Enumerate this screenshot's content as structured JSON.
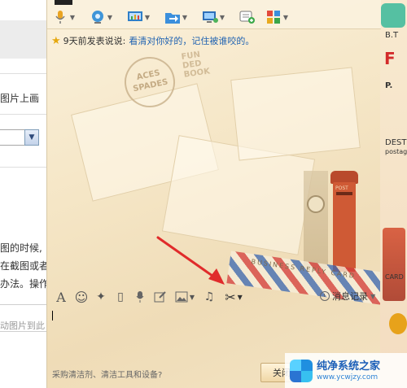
{
  "background_page": {
    "text_line_1": "图片上画",
    "text_line_2": "图的时候,",
    "text_line_3": "在截图或者",
    "text_line_4": "办法。操作",
    "hint": "动图片到此",
    "select_arrow": "▼"
  },
  "chat": {
    "status": {
      "prefix": "9天前发表说说:",
      "message": "看清对你好的，记住被谁咬的。"
    },
    "toolbar_icons": [
      "microphone-icon",
      "camera-icon",
      "screen-share-icon",
      "send-file-icon",
      "remote-desktop-icon",
      "add-app-icon",
      "app-grid-icon"
    ],
    "format_toolbar": {
      "font": "A",
      "emoji": "☺",
      "shake": "✦",
      "gif": "▯",
      "voice": "♪",
      "music": "♫",
      "scissors": "✂"
    },
    "history_label": "消息记录",
    "ad_text": "采购清洁剂、清洁工具和设备?",
    "close_button": "关闭",
    "decor": {
      "stamp_aces": "ACES SPADES",
      "stamp_funded": "FUN DED BOOK",
      "post_label": "POST",
      "card_text": "BUSINESS REPLY CARD",
      "right_letters": "F",
      "right_p": "P.",
      "right_dest": "DEST",
      "right_postage": "postag",
      "right_card": "CARD",
      "right_bt": "B.T"
    }
  },
  "watermark": {
    "title": "纯净系统之家",
    "url": "www.ycwjzy.com"
  },
  "colors": {
    "link": "#1f62b1",
    "accent_red": "#e02b2b",
    "chat_background": "#f5e6c6"
  }
}
